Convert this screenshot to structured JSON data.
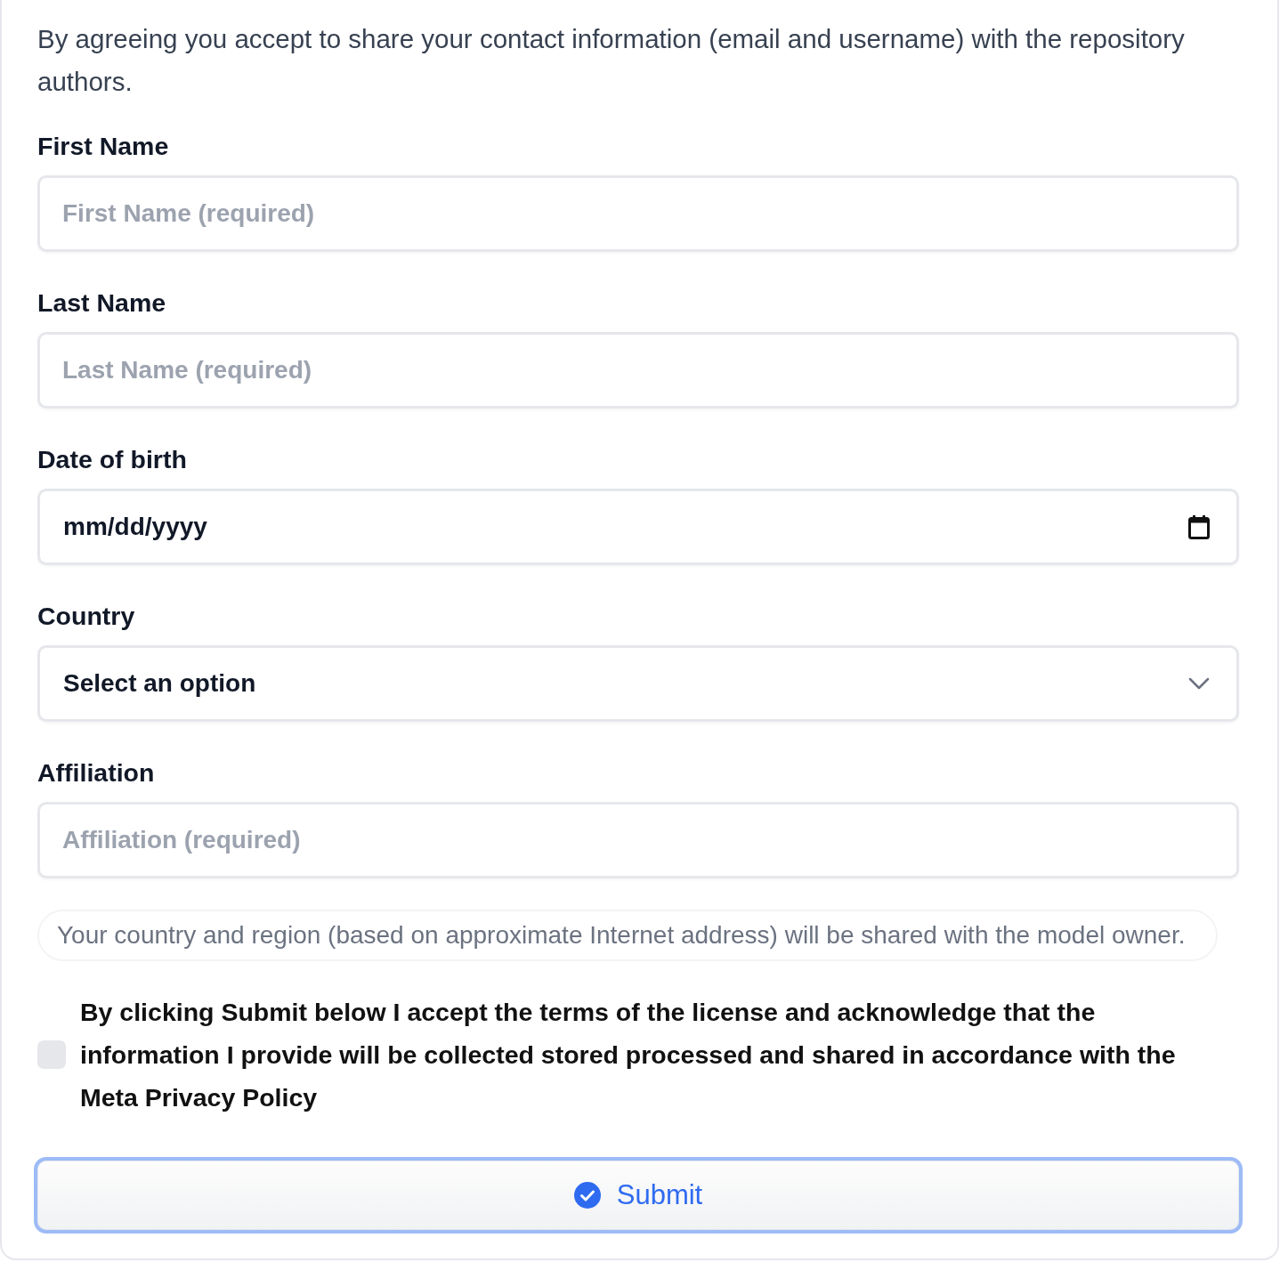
{
  "intro_text": "By agreeing you accept to share your contact information (email and username) with the repository authors.",
  "fields": [
    {
      "kind": "text",
      "label": "First Name",
      "placeholder": "First Name (required)"
    },
    {
      "kind": "text",
      "label": "Last Name",
      "placeholder": "Last Name (required)"
    },
    {
      "kind": "date",
      "label": "Date of birth",
      "placeholder": "mm/dd/yyyy"
    },
    {
      "kind": "select",
      "label": "Country",
      "value": "Select an option"
    },
    {
      "kind": "text",
      "label": "Affiliation",
      "placeholder": "Affiliation (required)"
    }
  ],
  "notice": "Your country and region (based on approximate Internet address) will be shared with the model owner.",
  "consent": {
    "checked": false,
    "text": "By clicking Submit below I accept the terms of the license and acknowledge that the information I provide will be collected stored processed and shared in accordance with the Meta Privacy Policy"
  },
  "submit_button": {
    "label": "Submit",
    "focused": true
  }
}
